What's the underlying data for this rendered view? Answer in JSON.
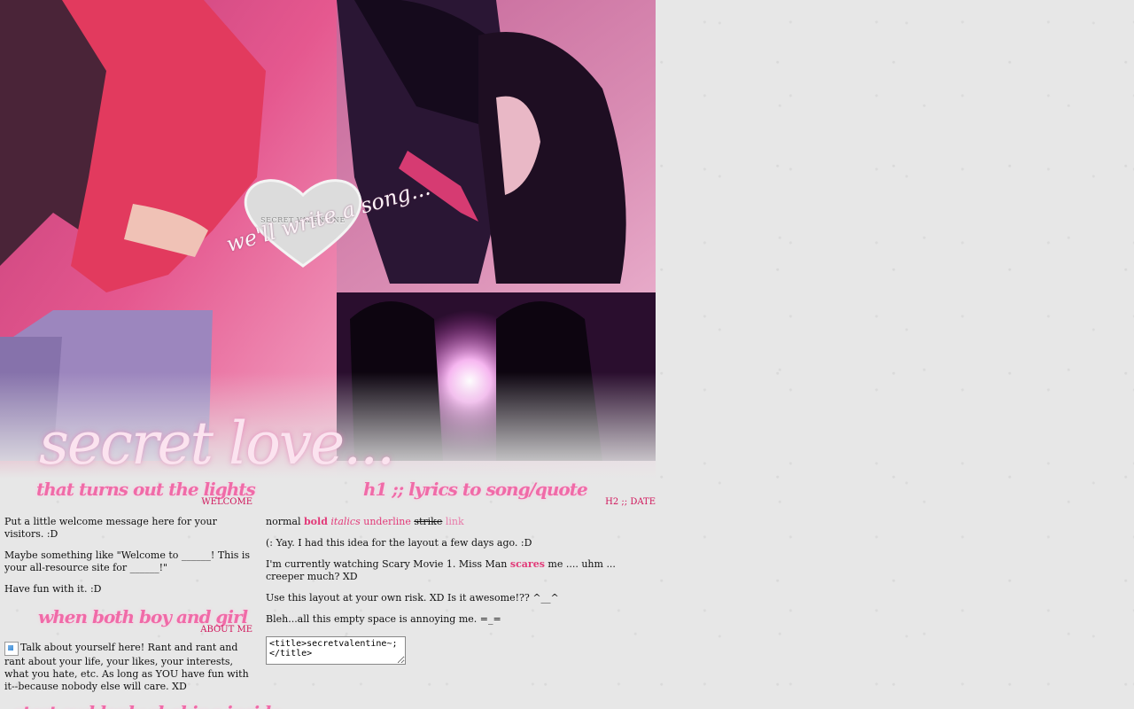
{
  "banner": {
    "heart_label": "SECRET VALENTINE",
    "script_line": "we'll write a song...",
    "title": "secret love..."
  },
  "left": {
    "section1": {
      "heading": "that turns out the lights",
      "tag": "WELCOME",
      "paragraphs": [
        "Put a little welcome message here for your visitors. :D",
        "Maybe something like \"Welcome to ______! This is your all-resource site for ______!\"",
        "Have fun with it. :D"
      ]
    },
    "section2": {
      "heading": "when both boy and girl",
      "tag": "ABOUT ME",
      "text": "Talk about yourself here! Rant and rant and rant about your life, your likes, your interests, what you hate, etc. As long as YOU have fun with it--because nobody else will care. XD"
    },
    "section3": {
      "heading": "start suddenly shaking inside"
    }
  },
  "right": {
    "heading": "h1 ;; lyrics to song/quote",
    "tag": "H2 ;; DATE",
    "format_demo": {
      "normal": "normal",
      "bold": "bold",
      "italics": "italics",
      "underline": "underline",
      "strike": "strike",
      "link": "link"
    },
    "line1": "(: Yay. I had this idea for the layout a few days ago. :D",
    "line2_before": "I'm currently watching Scary Movie 1. Miss Man",
    "line2_bold": "scares",
    "line2_after": "me .... uhm ... creeper much? XD",
    "line3": "Use this layout at your own risk. XD Is it awesome!?? ^__^",
    "line4": "Bleh...all this empty space is annoying me. =_=",
    "code_box": "<title>secretvalentine~;</title>"
  },
  "colors": {
    "heading_pink": "#f06ba8",
    "tag_red": "#d0145a",
    "accent_pink": "#e23a79",
    "background": "#e7e7e7"
  }
}
